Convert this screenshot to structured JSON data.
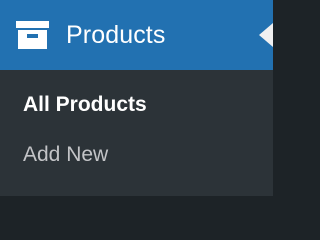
{
  "menu": {
    "top_label": "Products",
    "top_icon": "archive-box-icon",
    "colors": {
      "active_bg": "#2271b1",
      "submenu_bg": "#2c3338",
      "sidebar_bg": "#1d2327",
      "text_active": "#ffffff",
      "text_muted": "#c3c4c7",
      "pointer": "#f0f0f1"
    }
  },
  "submenu": {
    "items": [
      {
        "label": "All Products",
        "current": true
      },
      {
        "label": "Add New",
        "current": false
      }
    ]
  }
}
